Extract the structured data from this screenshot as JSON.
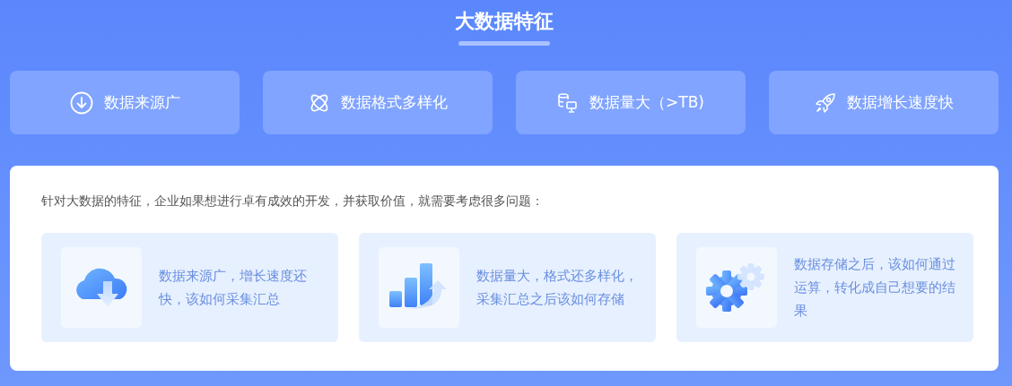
{
  "title": "大数据特征",
  "features": [
    {
      "kind": "download",
      "label": "数据来源广"
    },
    {
      "kind": "atom",
      "label": "数据格式多样化"
    },
    {
      "kind": "database",
      "label": "数据量大（>TB)"
    },
    {
      "kind": "rocket",
      "label": "数据增长速度快"
    }
  ],
  "panel": {
    "intro": "针对大数据的特征，企业如果想进行卓有成效的开发，并获取价值，就需要考虑很多问题：",
    "problems": [
      {
        "kind": "cloud",
        "text": "数据来源广，增长速度还快，该如何采集汇总"
      },
      {
        "kind": "chart",
        "text": "数据量大，格式还多样化，采集汇总之后该如何存储"
      },
      {
        "kind": "gears",
        "text": "数据存储之后，该如何通过运算，转化成自己想要的结果"
      }
    ]
  }
}
